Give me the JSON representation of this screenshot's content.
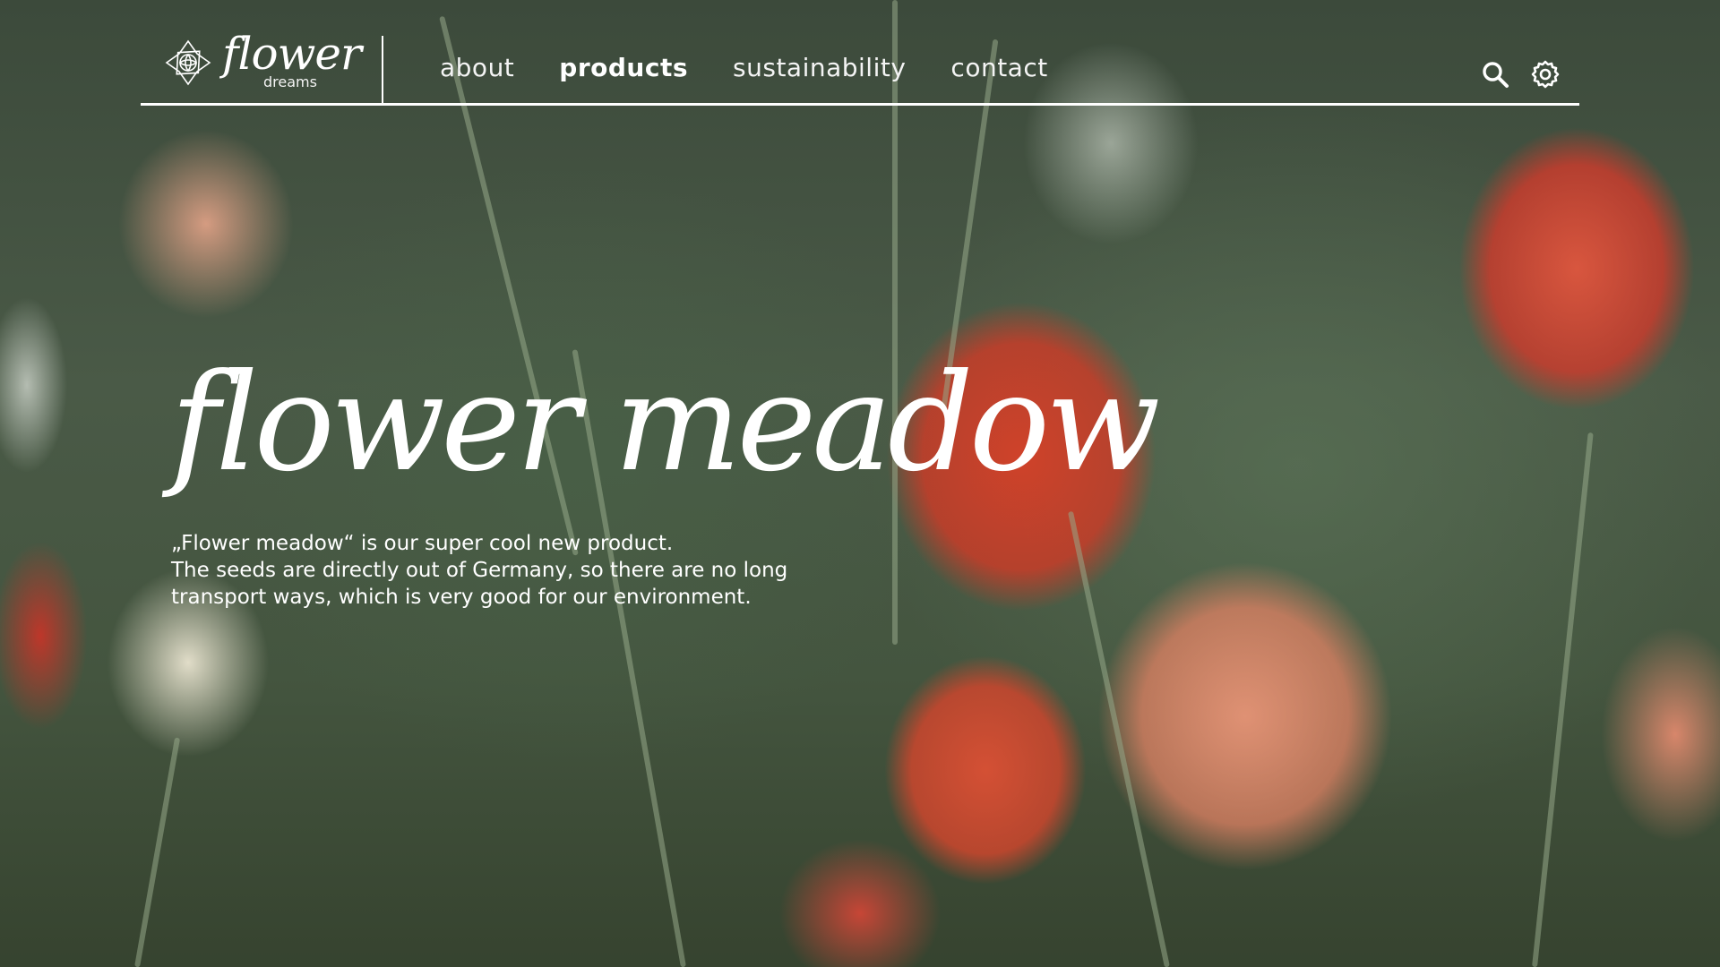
{
  "brand": {
    "name": "flower",
    "tagline": "dreams",
    "logo_icon": "flower-outline-icon"
  },
  "nav": {
    "items": [
      {
        "label": "about",
        "active": false
      },
      {
        "label": "products",
        "active": true
      },
      {
        "label": "sustainability",
        "active": false
      },
      {
        "label": "contact",
        "active": false
      }
    ]
  },
  "header_icons": {
    "search": "search-icon",
    "settings": "gear-icon"
  },
  "hero": {
    "title": "flower meadow",
    "lines": [
      "„Flower meadow“ is our super cool new product.",
      "The seeds are directly out of Germany, so there are no long",
      "transport ways, which is very good for our environment."
    ]
  },
  "colors": {
    "text": "#ffffff",
    "accent_red": "#d6402b",
    "accent_peach": "#ec9678",
    "foliage": "#4a5a47"
  }
}
